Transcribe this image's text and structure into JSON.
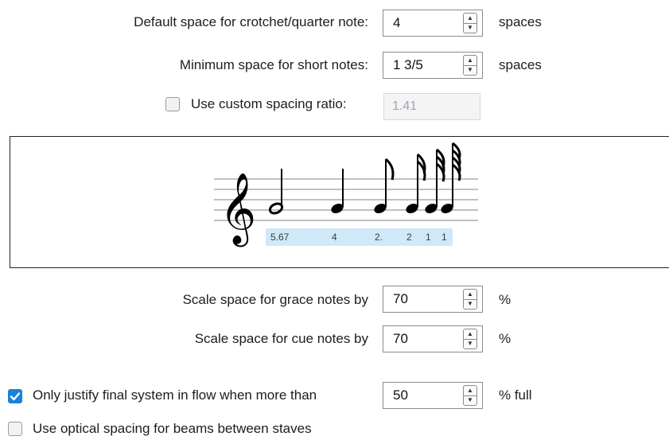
{
  "default_space": {
    "label": "Default space for crotchet/quarter note:",
    "value": "4",
    "unit": "spaces"
  },
  "minimum_space": {
    "label": "Minimum space for short notes:",
    "value": "1 3/5",
    "unit": "spaces"
  },
  "custom_ratio": {
    "label": "Use custom spacing ratio:",
    "checked": false,
    "value": "1.41"
  },
  "preview": {
    "spacing_labels": [
      "5.67",
      "4",
      "2.",
      "2",
      "1",
      "1"
    ]
  },
  "grace_notes": {
    "label": "Scale space for grace notes by",
    "value": "70",
    "unit": "%"
  },
  "cue_notes": {
    "label": "Scale space for cue notes by",
    "value": "70",
    "unit": "%"
  },
  "justify": {
    "label": "Only justify final system in flow when more than",
    "checked": true,
    "value": "50",
    "unit": "% full"
  },
  "optical": {
    "label": "Use optical spacing for beams between staves",
    "checked": false
  },
  "colors": {
    "accent": "#1a82d8",
    "label_fill": "#cfe9f8"
  }
}
